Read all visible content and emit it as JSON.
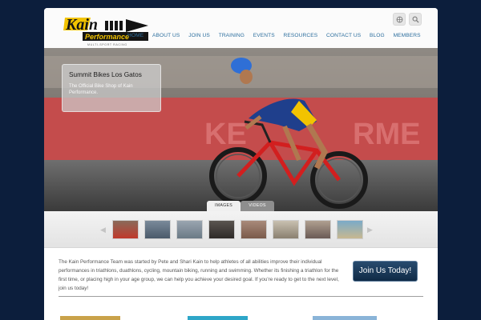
{
  "logo": {
    "text": "Kain",
    "subtext": "Performance",
    "tagline": "MULTI-SPORT RACING"
  },
  "nav": [
    "HOME",
    "ABOUT US",
    "JOIN US",
    "TRAINING",
    "EVENTS",
    "RESOURCES",
    "CONTACT US",
    "BLOG",
    "MEMBERS"
  ],
  "hero": {
    "caption_title": "Summit Bikes Los Gatos",
    "caption_text": "The Official Bike Shop of Kain Performance.",
    "tabs": [
      "IMAGES",
      "VIDEOS"
    ]
  },
  "intro_text": "The Kain Performance Team was started by Pete and Shari Kain to help athletes of all abilities improve their individual performances in triathlons, duathlons, cycling, mountain biking, running and swimming. Whether its finishing a triathlon for the first time, or placing high in your age group, we can help you achieve your desired goal. If you're ready to get to the next level, join us today!",
  "join_button": "Join Us Today!",
  "colors": {
    "accent": "#2c6e9e",
    "brand_yellow": "#f2c300",
    "background": "#0c1e3c"
  },
  "icons": [
    "globe-icon",
    "search-icon",
    "arrow-left-icon",
    "arrow-right-icon"
  ]
}
